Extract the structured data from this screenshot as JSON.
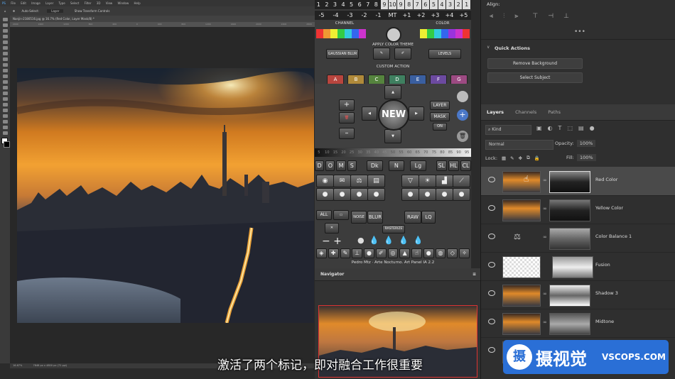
{
  "menubar": {
    "items": [
      "PS",
      "File",
      "Edit",
      "Image",
      "Layer",
      "Type",
      "Select",
      "Filter",
      "3D",
      "View",
      "Window",
      "Help"
    ]
  },
  "options_bar": {
    "auto_select": "Auto-Select:",
    "layer": "Layer",
    "transform": "Show Transform Controls"
  },
  "document": {
    "tab": "Nanjin-2180516.jpg @ 16.7% (Red Color, Layer Mask/8) *",
    "zoom": "16.67%",
    "doc_size": "7848 px x 4800 px (72 ppi)",
    "ruler_marks": [
      "2000",
      "1800",
      "1600",
      "1400",
      "1200",
      "1000",
      "800",
      "600",
      "400",
      "200",
      "0",
      "200",
      "400",
      "600",
      "800",
      "1000",
      "1200",
      "1400",
      "1600",
      "1800",
      "2000",
      "2200",
      "2400",
      "2600",
      "2800",
      "3000"
    ]
  },
  "art_panel": {
    "top_numbers": [
      "1",
      "2",
      "3",
      "4",
      "5",
      "6",
      "7",
      "8",
      "9",
      "10",
      "9",
      "8",
      "7",
      "6",
      "5",
      "4",
      "3",
      "2",
      "1"
    ],
    "adjust_buttons": [
      "-5",
      "-4",
      "-3",
      "-2",
      "-1",
      "MT",
      "+1",
      "+2",
      "+3",
      "+4",
      "+5"
    ],
    "channel_label": "CHANNEL",
    "color_label": "COLOR",
    "apply_theme_label": "APPLY COLOR THEME",
    "gaussian_blur": "GAUSSIAN BLUR",
    "levels": "LEVELS",
    "custom_action_label": "CUSTOM ACTION",
    "custom_actions": [
      "A",
      "B",
      "C",
      "D",
      "E",
      "F",
      "G"
    ],
    "new_label": "NEW",
    "layer_label": "LAYER",
    "mask_label": "MASK",
    "on_label": "ON",
    "scale_numbers": [
      "5",
      "10",
      "15",
      "20",
      "25",
      "30",
      "35",
      "40",
      "45",
      "50",
      "55",
      "60",
      "65",
      "70",
      "75",
      "80",
      "85",
      "90",
      "95"
    ],
    "mode_buttons": [
      "D",
      "O",
      "M",
      "S",
      "Dk",
      "N",
      "Lg",
      "SL",
      "HL",
      "CL"
    ],
    "all_label": "ALL",
    "noise_label": "NOISE",
    "blur_label": "BLUR",
    "raw_label": "RAW",
    "lq_label": "LQ",
    "rasterize_label": "RASTERIZE",
    "credit": "Pedro Mtz · Arte Nocturno. Art Panel IA 2.2",
    "colors": {
      "a": "#b8453e",
      "b": "#b08a3a",
      "c": "#55843e",
      "d": "#3f8060",
      "e": "#3a5fa0",
      "f": "#6c4aa0",
      "g": "#9c4a82"
    }
  },
  "navigator": {
    "title": "Navigator"
  },
  "align": {
    "title": "Align:"
  },
  "quick_actions": {
    "title": "Quick Actions",
    "remove_background": "Remove Background",
    "select_subject": "Select Subject"
  },
  "layers_panel": {
    "tabs": [
      "Layers",
      "Channels",
      "Paths"
    ],
    "kind": "Kind",
    "blend_mode": "Normal",
    "opacity_label": "Opacity:",
    "opacity_value": "100%",
    "lock_label": "Lock:",
    "fill_label": "Fill:",
    "fill_value": "100%",
    "layers": [
      {
        "name": "Red Color"
      },
      {
        "name": "Yellow Color"
      },
      {
        "name": "Color Balance 1"
      },
      {
        "name": "Fusion"
      },
      {
        "name": "Shadow 3"
      },
      {
        "name": "Midtone"
      }
    ]
  },
  "subtitle": "激活了两个标记，即对融合工作很重要",
  "watermark": {
    "logo_char": "摄",
    "name": "摄视觉",
    "site": "VSCOPS.COM"
  }
}
